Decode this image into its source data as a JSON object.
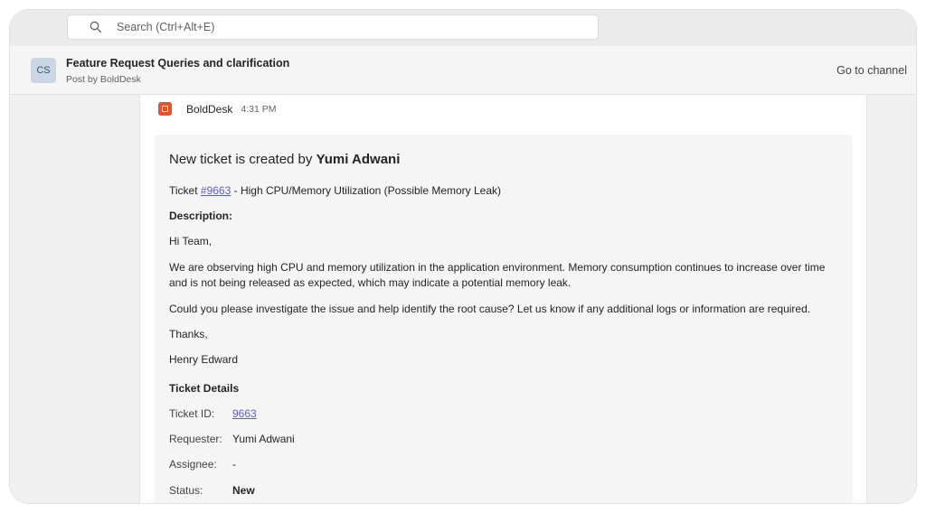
{
  "search": {
    "placeholder": "Search (Ctrl+Alt+E)"
  },
  "header": {
    "avatar": "CS",
    "title": "Feature Request Queries and clarification",
    "subtitle": "Post by BoldDesk",
    "goto": "Go to channel"
  },
  "message": {
    "sender": "BoldDesk",
    "time": "4:31 PM",
    "card_title_prefix": "New ticket is created by",
    "card_title_name": "Yumi Adwani",
    "ticket_prefix": "Ticket",
    "ticket_link": "#9663",
    "ticket_suffix": " - High CPU/Memory Utilization (Possible Memory Leak)",
    "description_label": "Description:",
    "greeting": "Hi Team,",
    "para1": "We are observing high CPU and memory utilization in the application environment. Memory consumption continues to increase over time and is not being released as expected, which may indicate a potential memory leak.",
    "para2": "Could you please investigate the issue and help identify the root cause? Let us know if any additional logs or information are required.",
    "thanks": "Thanks,",
    "signature": "Henry Edward",
    "details_heading": "Ticket Details",
    "details": {
      "id_label": "Ticket ID:",
      "id_value": "9663",
      "requester_label": "Requester:",
      "requester_value": "Yumi Adwani",
      "assignee_label": "Assignee:",
      "assignee_value": "-",
      "status_label": "Status:",
      "status_value": "New"
    }
  },
  "colors": {
    "accent": "#5b5fc7",
    "brand": "#e2552c"
  }
}
